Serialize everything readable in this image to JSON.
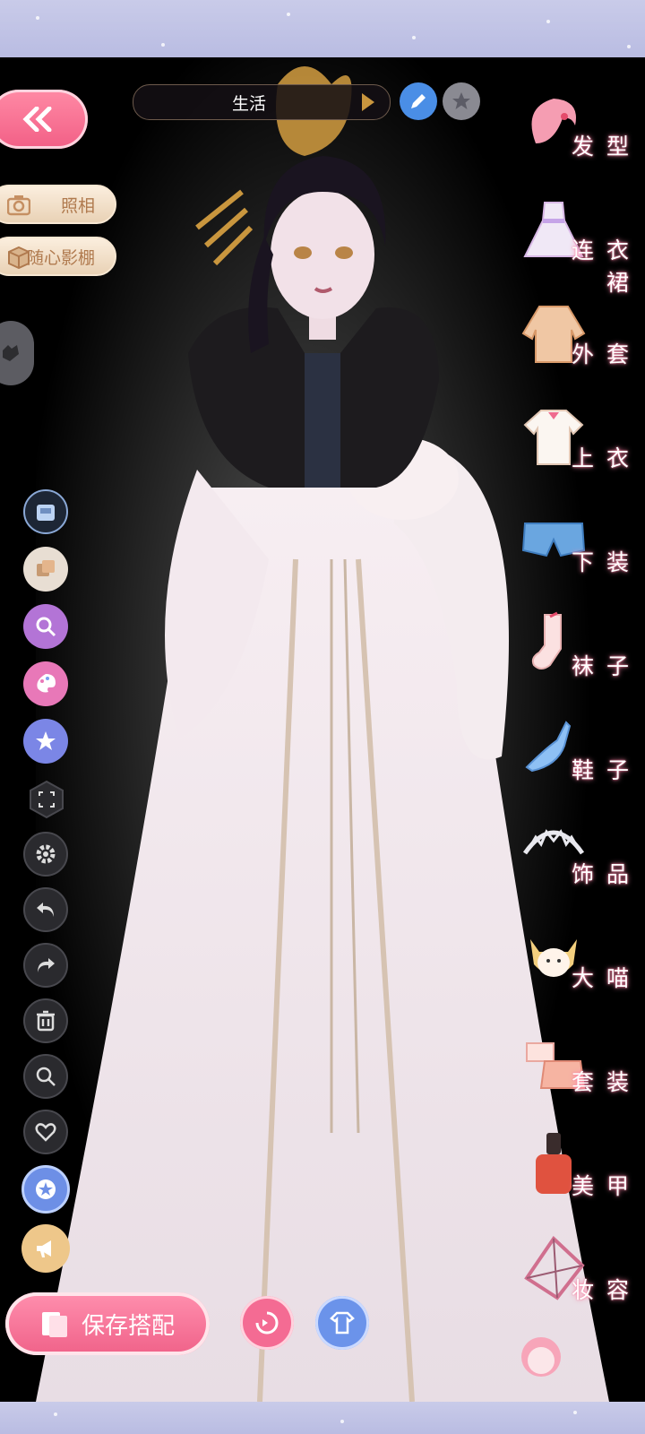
{
  "theme_bar": {
    "label": "生活"
  },
  "left_panel": {
    "photo_label": "照相",
    "studio_label": "随心影棚"
  },
  "categories": [
    {
      "label": "发型",
      "icon": "hair-icon"
    },
    {
      "label": "连衣裙",
      "icon": "dress-icon"
    },
    {
      "label": "外套",
      "icon": "coat-icon"
    },
    {
      "label": "上衣",
      "icon": "shirt-icon"
    },
    {
      "label": "下装",
      "icon": "shorts-icon"
    },
    {
      "label": "袜子",
      "icon": "sock-icon"
    },
    {
      "label": "鞋子",
      "icon": "shoe-icon"
    },
    {
      "label": "饰品",
      "icon": "tiara-icon"
    },
    {
      "label": "大喵",
      "icon": "cat-icon"
    },
    {
      "label": "套装",
      "icon": "outfit-set-icon"
    },
    {
      "label": "美甲",
      "icon": "nail-polish-icon"
    },
    {
      "label": "妆容",
      "icon": "makeup-icon"
    }
  ],
  "actions": {
    "save_label": "保存搭配"
  },
  "colors": {
    "accent_pink": "#f06289",
    "gold": "#c9963e",
    "background": "#000000"
  }
}
